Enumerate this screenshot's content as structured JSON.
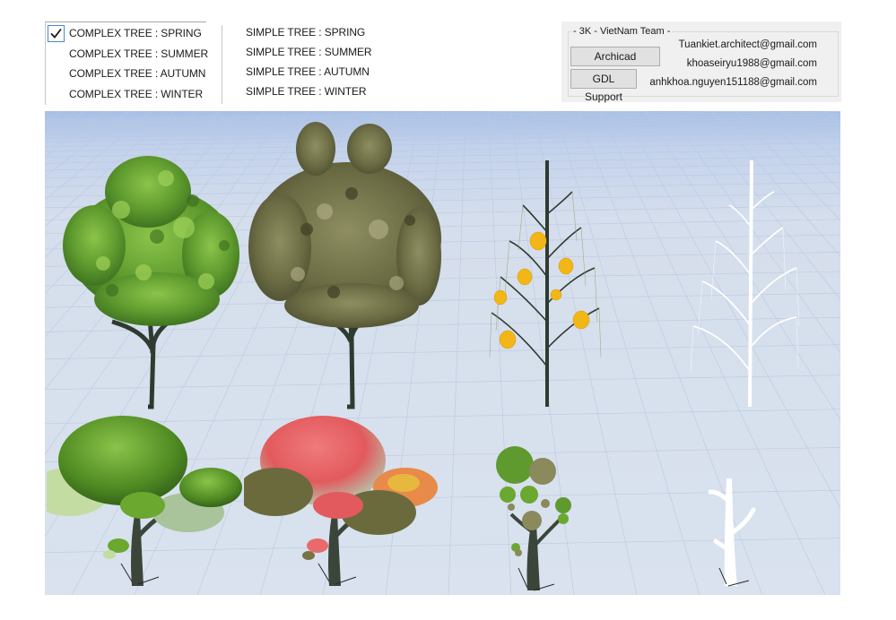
{
  "tree_options": {
    "complex": [
      {
        "label": "COMPLEX TREE : SPRING",
        "checked": true
      },
      {
        "label": "COMPLEX TREE : SUMMER",
        "checked": false
      },
      {
        "label": "COMPLEX TREE : AUTUMN",
        "checked": false
      },
      {
        "label": "COMPLEX TREE : WINTER",
        "checked": false
      }
    ],
    "simple": [
      {
        "label": "SIMPLE TREE : SPRING"
      },
      {
        "label": "SIMPLE TREE : SUMMER"
      },
      {
        "label": "SIMPLE TREE : AUTUMN"
      },
      {
        "label": "SIMPLE TREE : WINTER"
      }
    ]
  },
  "team": {
    "title": "- 3K - VietNam Team -",
    "buttons": {
      "archicad": "Archicad Support",
      "gdl": "GDL Support"
    },
    "emails": [
      "Tuankiet.architect@gmail.com",
      "khoaseiryu1988@gmail.com",
      "anhkhoa.nguyen151188@gmail.com"
    ]
  },
  "viewport": {
    "icons": [
      "axis-gizmo-icon"
    ],
    "colors": {
      "sky_top": "#a8bfe6",
      "ground": "#d9e2ee",
      "grid": "#b9c9e2",
      "spring_leaf": "#5e9a2e",
      "summer_leaf": "#6d6d45",
      "fruit": "#f2b617",
      "winter": "#ffffff",
      "trunk": "#3a4038"
    },
    "trees": [
      {
        "kind": "complex",
        "season": "spring"
      },
      {
        "kind": "complex",
        "season": "summer"
      },
      {
        "kind": "complex",
        "season": "autumn"
      },
      {
        "kind": "complex",
        "season": "winter"
      },
      {
        "kind": "simple",
        "season": "spring"
      },
      {
        "kind": "simple",
        "season": "summer"
      },
      {
        "kind": "simple",
        "season": "autumn"
      },
      {
        "kind": "simple",
        "season": "winter"
      }
    ]
  }
}
